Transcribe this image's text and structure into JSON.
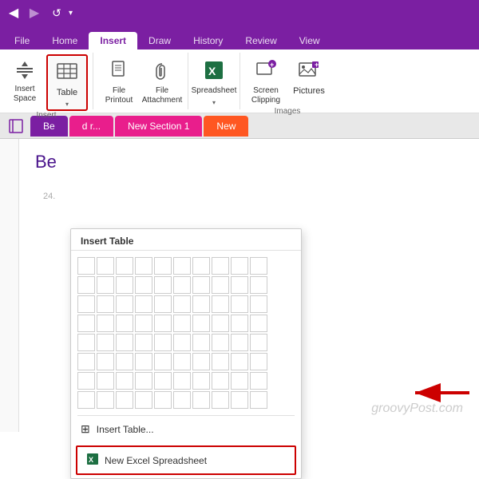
{
  "titleBar": {
    "backLabel": "◀",
    "forwardLabel": "▶",
    "undoLabel": "↺",
    "dropdownLabel": "▾"
  },
  "ribbonTabs": {
    "tabs": [
      {
        "label": "File",
        "active": false
      },
      {
        "label": "Home",
        "active": false
      },
      {
        "label": "Insert",
        "active": true
      },
      {
        "label": "Draw",
        "active": false
      },
      {
        "label": "History",
        "active": false
      },
      {
        "label": "Review",
        "active": false
      },
      {
        "label": "View",
        "active": false
      }
    ]
  },
  "ribbonGroups": {
    "insert": {
      "label": "Insert",
      "insertSpaceLabel": "Insert\nSpace",
      "tableLabel": "Table",
      "tableCaretLabel": "▾",
      "filePrintoutLabel": "File\nPrintout",
      "fileAttachmentLabel": "File\nAttachment",
      "spreadsheetLabel": "Spreadsheet",
      "spreadsheetCaretLabel": "▾",
      "screenClippingLabel": "Screen\nClipping",
      "picturesLabel": "Pictures",
      "imagesGroupLabel": "Images",
      "insertGroupLabel": "Insert"
    }
  },
  "sectionTabs": [
    {
      "label": "Be",
      "color": "purple"
    },
    {
      "label": "d r...",
      "color": "pink"
    },
    {
      "label": "New Section 1",
      "color": "pink"
    },
    {
      "label": "New",
      "color": "orange"
    }
  ],
  "pageContent": {
    "title": "Be",
    "lineNumber": "24.",
    "watermark": "groovyPost.com"
  },
  "dropdown": {
    "title": "Insert Table",
    "insertTableLabel": "Insert Table...",
    "newExcelLabel": "New Excel Spreadsheet",
    "tableIconUnicode": "▦"
  },
  "colors": {
    "purple": "#7B1FA2",
    "pink": "#E91E8C",
    "orange": "#FF5722",
    "red": "#CC0000",
    "activeOutline": "#CC0000"
  }
}
